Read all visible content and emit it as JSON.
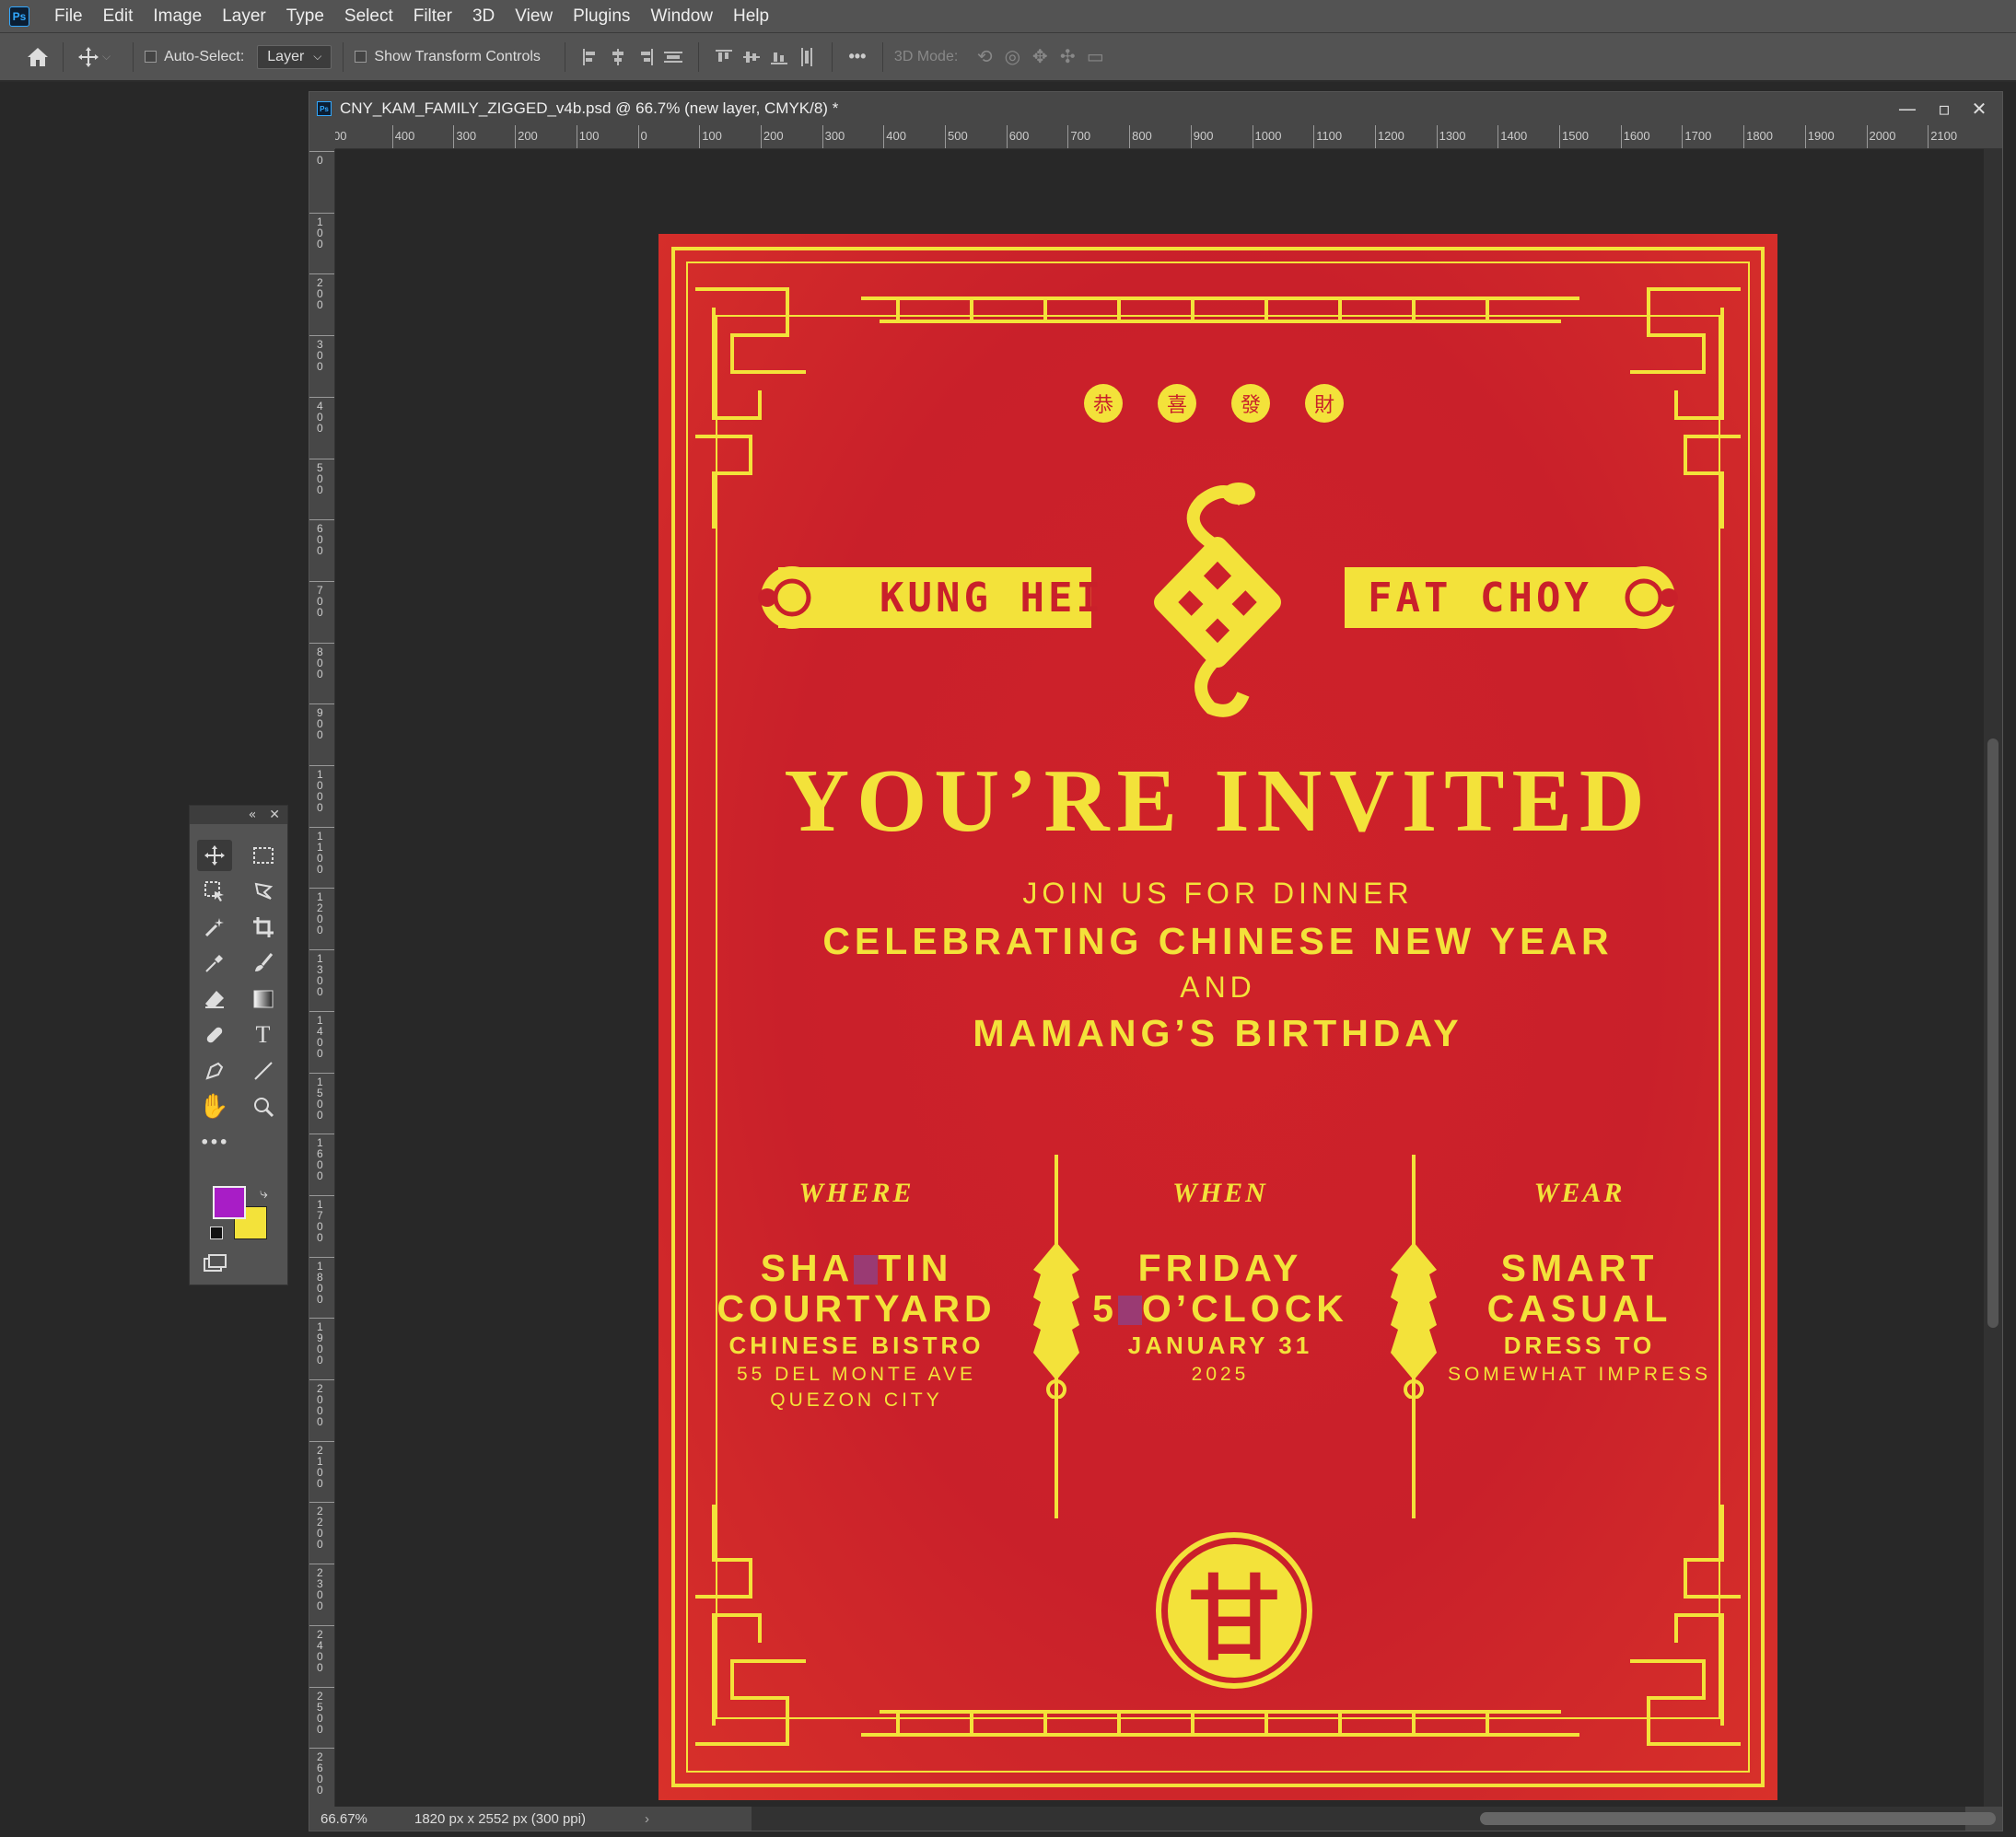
{
  "app": {
    "name": "Photoshop",
    "logo_text": "Ps"
  },
  "menubar": {
    "items": [
      "File",
      "Edit",
      "Image",
      "Layer",
      "Type",
      "Select",
      "Filter",
      "3D",
      "View",
      "Plugins",
      "Window",
      "Help"
    ]
  },
  "options": {
    "auto_select_label": "Auto-Select:",
    "auto_select_target": "Layer",
    "show_transform_label": "Show Transform Controls",
    "mode_3d_label": "3D Mode:",
    "more": "•••"
  },
  "document": {
    "tab_title": "CNY_KAM_FAMILY_ZIGGED_v4b.psd @ 66.7% (new layer, CMYK/8) *",
    "zoom": "66.67%",
    "doc_info": "1820 px x 2552 px (300 ppi)"
  },
  "rulers": {
    "top": [
      "00",
      "400",
      "300",
      "200",
      "100",
      "0",
      "100",
      "200",
      "300",
      "400",
      "500",
      "600",
      "700",
      "800",
      "900",
      "1000",
      "1100",
      "1200",
      "1300",
      "1400",
      "1500",
      "1600",
      "1700",
      "1800",
      "1900",
      "2000",
      "2100"
    ],
    "left": [
      "0",
      "100",
      "200",
      "300",
      "400",
      "500",
      "600",
      "700",
      "800",
      "900",
      "1000",
      "1100",
      "1200",
      "1300",
      "1400",
      "1500",
      "1600",
      "1700",
      "1800",
      "1900",
      "2000",
      "2100",
      "2200",
      "2300",
      "2400",
      "2500",
      "2600"
    ]
  },
  "poster": {
    "coins": [
      "恭",
      "喜",
      "發",
      "財"
    ],
    "banner_left": "KUNG HEI",
    "banner_right": "FAT CHOY",
    "headline": "YOU’RE INVITED",
    "line1": "JOIN US FOR DINNER",
    "line2": "CELEBRATING CHINESE NEW YEAR",
    "line3": "AND",
    "line4": "MAMANG’S BIRTHDAY",
    "where": {
      "head": "WHERE",
      "big1a": "SHA",
      "big1b": "TIN",
      "big2": "COURTYARD",
      "mid": "CHINESE BISTRO",
      "small1": "55 DEL MONTE AVE",
      "small2": "QUEZON CITY"
    },
    "when": {
      "head": "WHEN",
      "big1": "FRIDAY",
      "big2a": "5",
      "big2b": "O’CLOCK",
      "mid": "JANUARY 31",
      "small1": "2025"
    },
    "wear": {
      "head": "WEAR",
      "big1": "SMART",
      "big2": "CASUAL",
      "mid": "DRESS TO",
      "small1": "SOMEWHAT IMPRESS"
    },
    "seal_char": "甘"
  },
  "colors": {
    "foreground": "#a81dc6",
    "background": "#f3e23a",
    "poster_red": "#c9202a",
    "poster_gold": "#f3e23a"
  },
  "tools_panel": {
    "icons": [
      "move-icon",
      "marquee-icon",
      "object-select-icon",
      "lasso-icon",
      "magic-wand-icon",
      "crop-icon",
      "eyedropper-icon",
      "brush-icon",
      "eraser-icon",
      "gradient-icon",
      "healing-icon",
      "type-icon",
      "pen-icon",
      "line-icon",
      "hand-icon",
      "zoom-icon",
      "more-tools-icon"
    ]
  }
}
